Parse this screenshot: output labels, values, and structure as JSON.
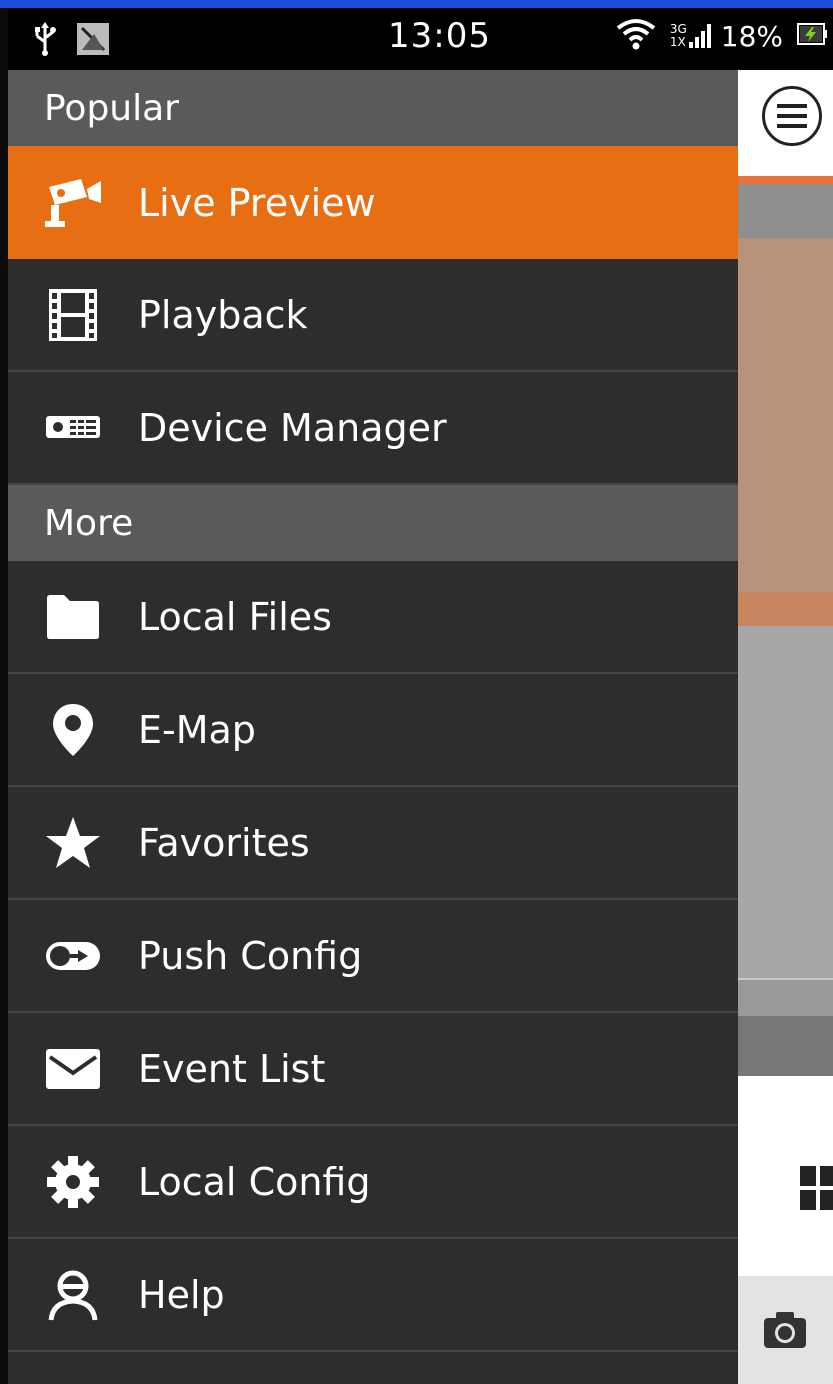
{
  "status_bar": {
    "time": "13:05",
    "battery_percent": "18%",
    "network_top": "3G",
    "network_bottom": "1X",
    "icons": [
      "usb-icon",
      "no-signal-image-icon",
      "wifi-icon",
      "cell-signal-icon",
      "battery-icon"
    ]
  },
  "drawer": {
    "sections": [
      {
        "header": "Popular",
        "items": [
          {
            "label": "Live Preview",
            "icon": "camera-icon",
            "active": true
          },
          {
            "label": "Playback",
            "icon": "film-icon"
          },
          {
            "label": "Device Manager",
            "icon": "dvr-icon"
          }
        ]
      },
      {
        "header": "More",
        "items": [
          {
            "label": "Local Files",
            "icon": "folder-icon"
          },
          {
            "label": "E-Map",
            "icon": "map-pin-icon"
          },
          {
            "label": "Favorites",
            "icon": "star-icon"
          },
          {
            "label": "Push Config",
            "icon": "push-toggle-icon"
          },
          {
            "label": "Event List",
            "icon": "envelope-icon"
          },
          {
            "label": "Local Config",
            "icon": "gear-icon"
          },
          {
            "label": "Help",
            "icon": "user-icon"
          }
        ]
      }
    ]
  },
  "colors": {
    "accent_active": "#e86e13",
    "drawer_bg": "#2d2d2d",
    "section_header_bg": "#5a5a5a",
    "top_accent": "#1f4fd6"
  }
}
